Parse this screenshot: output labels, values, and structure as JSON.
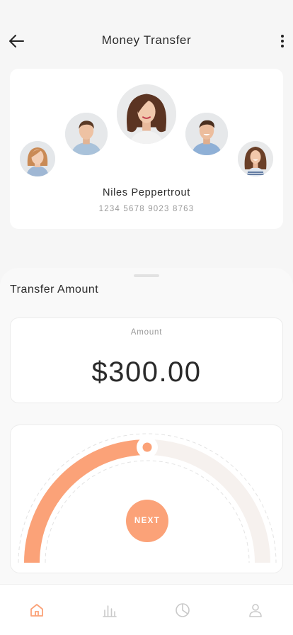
{
  "header": {
    "title": "Money Transfer",
    "back_icon": "arrow-left-icon",
    "more_icon": "more-vertical-icon"
  },
  "recipients": {
    "avatars": [
      {
        "name": "avatar-woman-blonde",
        "selected": false
      },
      {
        "name": "avatar-man-short-hair",
        "selected": false
      },
      {
        "name": "avatar-woman-curly",
        "selected": true
      },
      {
        "name": "avatar-man-smiling",
        "selected": false
      },
      {
        "name": "avatar-woman-brunette",
        "selected": false
      }
    ],
    "selected_name": "Niles Peppertrout",
    "card_number": "1234 5678 9023 8763"
  },
  "transfer": {
    "title": "Transfer Amount",
    "amount_label": "Amount",
    "amount_value": "$300.00",
    "dial_fraction": 0.5,
    "next_label": "NEXT"
  },
  "tabbar": {
    "items": [
      {
        "icon": "home-icon",
        "active": true
      },
      {
        "icon": "bar-chart-icon",
        "active": false
      },
      {
        "icon": "pie-chart-icon",
        "active": false
      },
      {
        "icon": "user-icon",
        "active": false
      }
    ]
  },
  "colors": {
    "accent": "#fba278",
    "track": "#f6f1ee",
    "inactive_icon": "#c9c9c9"
  }
}
